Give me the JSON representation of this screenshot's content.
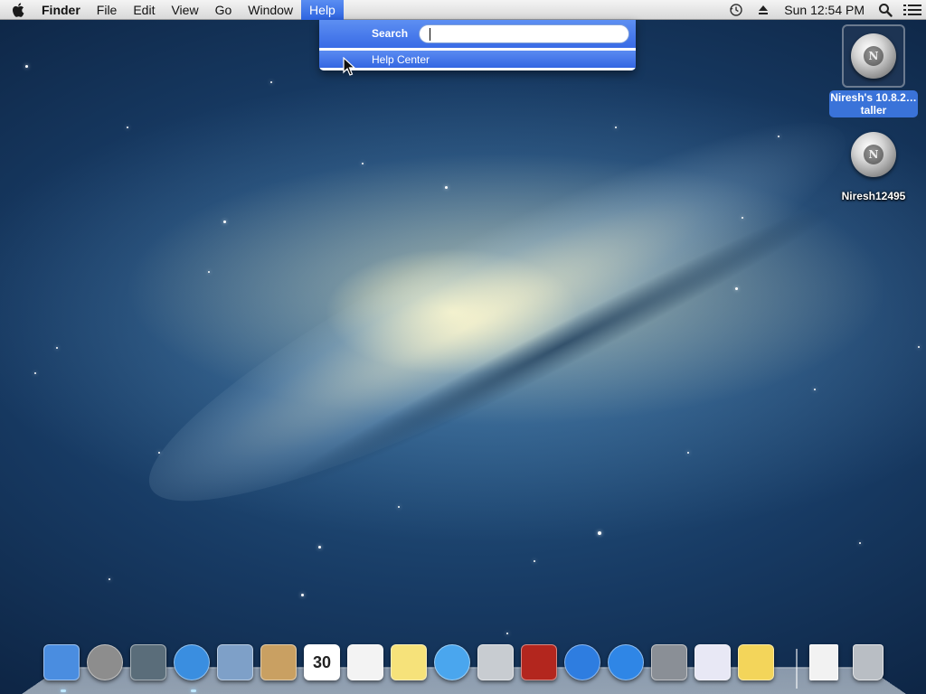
{
  "menubar": {
    "apple_icon": "apple-logo-icon",
    "app_name": "Finder",
    "menus": [
      "File",
      "Edit",
      "View",
      "Go",
      "Window",
      "Help"
    ],
    "active_menu": "Help",
    "status_icons": [
      "time-machine-icon",
      "eject-icon",
      "spotlight-search-icon",
      "notification-center-icon"
    ],
    "clock": "Sun 12:54 PM"
  },
  "help_menu": {
    "search_label": "Search",
    "search_value": "",
    "items": [
      "Help Center"
    ]
  },
  "desktop": {
    "icons": [
      {
        "label": "Niresh's 10.8.2…taller",
        "icon": "installer-disk-icon",
        "selected": true
      },
      {
        "label": "Niresh12495",
        "icon": "hard-disk-icon",
        "selected": false
      }
    ]
  },
  "dock": {
    "apps": [
      {
        "name": "Finder",
        "icon": "finder-icon",
        "color": "#4a8de0"
      },
      {
        "name": "Launchpad",
        "icon": "launchpad-rocket-icon",
        "color": "#8d8d8d"
      },
      {
        "name": "Mission Control",
        "icon": "mission-control-icon",
        "color": "#5a6d7a"
      },
      {
        "name": "Safari",
        "icon": "safari-compass-icon",
        "color": "#3a8ee0"
      },
      {
        "name": "Mail",
        "icon": "mail-stamp-icon",
        "color": "#7ea0c8"
      },
      {
        "name": "Contacts",
        "icon": "contacts-book-icon",
        "color": "#c9a062"
      },
      {
        "name": "Calendar",
        "icon": "calendar-icon",
        "color": "#ffffff",
        "text": "30"
      },
      {
        "name": "Reminders",
        "icon": "reminders-icon",
        "color": "#f3f3f3"
      },
      {
        "name": "Notes",
        "icon": "notes-icon",
        "color": "#f6e27a"
      },
      {
        "name": "Messages",
        "icon": "messages-bubble-icon",
        "color": "#4aa6ee"
      },
      {
        "name": "FaceTime",
        "icon": "facetime-camera-icon",
        "color": "#c8ccd1"
      },
      {
        "name": "Photo Booth",
        "icon": "photo-booth-icon",
        "color": "#b3261e"
      },
      {
        "name": "iTunes",
        "icon": "itunes-note-icon",
        "color": "#2e7de0"
      },
      {
        "name": "App Store",
        "icon": "app-store-icon",
        "color": "#2f86e6"
      },
      {
        "name": "System Preferences",
        "icon": "system-preferences-gear-icon",
        "color": "#8a8f96"
      },
      {
        "name": "Wizard",
        "icon": "wizard-icon",
        "color": "#e8e8f5"
      },
      {
        "name": "Stickies",
        "icon": "stickies-icon",
        "color": "#f3d55a"
      }
    ],
    "others": [
      {
        "name": "Document",
        "icon": "document-stack-icon",
        "color": "#f2f2f2"
      },
      {
        "name": "Trash",
        "icon": "trash-icon",
        "color": "#b9bec4"
      }
    ]
  }
}
